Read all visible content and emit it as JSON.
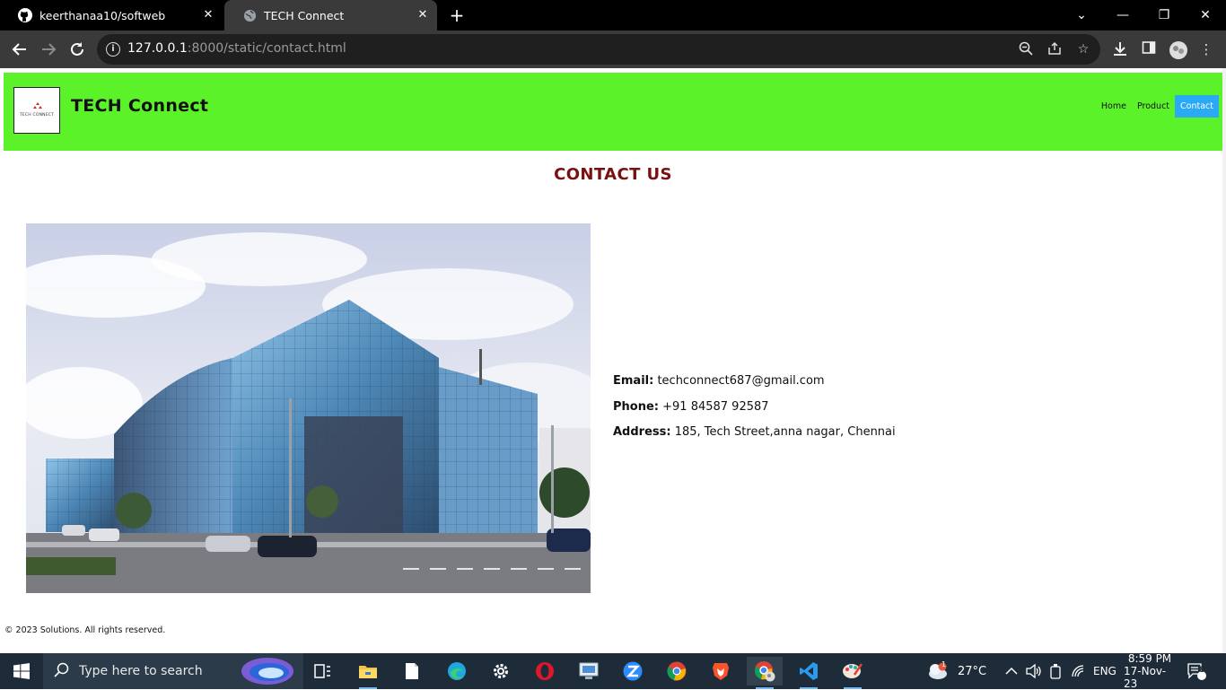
{
  "browser": {
    "tabs": [
      {
        "label": "keerthanaa10/softweb",
        "icon": "github-icon"
      },
      {
        "label": "TECH Connect",
        "icon": "globe-icon"
      }
    ],
    "url_host": "127.0.0.1",
    "url_rest": ":8000/static/contact.html"
  },
  "site": {
    "brand": "TECH Connect",
    "logo_text": "TECH CONNECT",
    "nav": [
      "Home",
      "Product",
      "Contact"
    ],
    "active_nav": "Contact",
    "accent_green": "#5cf22a",
    "accent_blue": "#2aa9f5"
  },
  "page": {
    "heading": "CONTACT US",
    "heading_color": "#7a1010",
    "contact": {
      "email_label": "Email:",
      "email": "techconnect687@gmail.com",
      "phone_label": "Phone:",
      "phone": "+91 84587 92587",
      "address_label": "Address:",
      "address": "185, Tech Street,anna nagar, Chennai"
    },
    "footer": "© 2023 Solutions. All rights reserved."
  },
  "taskbar": {
    "search_placeholder": "Type here to search",
    "weather_temp": "27°C",
    "weather_badge": "1",
    "language": "ENG",
    "time": "8:59 PM",
    "date": "17-Nov-23",
    "notification_count": "8"
  }
}
